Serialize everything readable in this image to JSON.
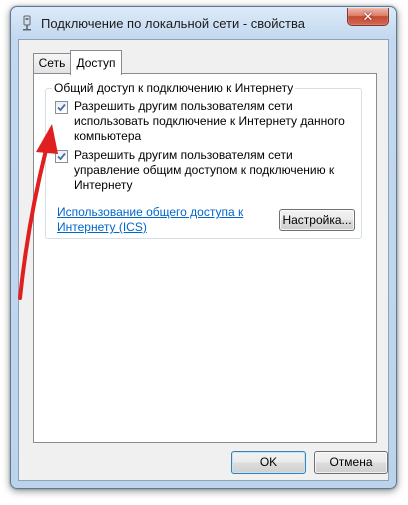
{
  "window": {
    "title": "Подключение по локальной сети - свойства",
    "close_glyph": "✕"
  },
  "tabs": [
    {
      "label": "Сеть",
      "active": false
    },
    {
      "label": "Доступ",
      "active": true
    }
  ],
  "group": {
    "title": "Общий доступ к подключению к Интернету",
    "checkboxes": [
      {
        "label": "Разрешить другим пользователям сети использовать подключение к Интернету данного компьютера",
        "checked": true
      },
      {
        "label": "Разрешить другим пользователям сети управление общим доступом к подключению к Интернету",
        "checked": true
      }
    ],
    "link": "Использование общего доступа к Интернету (ICS)",
    "settings_button": "Настройка..."
  },
  "buttons": {
    "ok": "OK",
    "cancel": "Отмена"
  },
  "icons": {
    "title": "network-connection-icon",
    "close": "close-icon",
    "check": "checkmark-icon",
    "annotation": "red-arrow-icon"
  },
  "colors": {
    "link": "#0066cc",
    "annotation_arrow": "#e02020",
    "close_button": "#c34a36",
    "window_frame": "#bcd3ec"
  }
}
